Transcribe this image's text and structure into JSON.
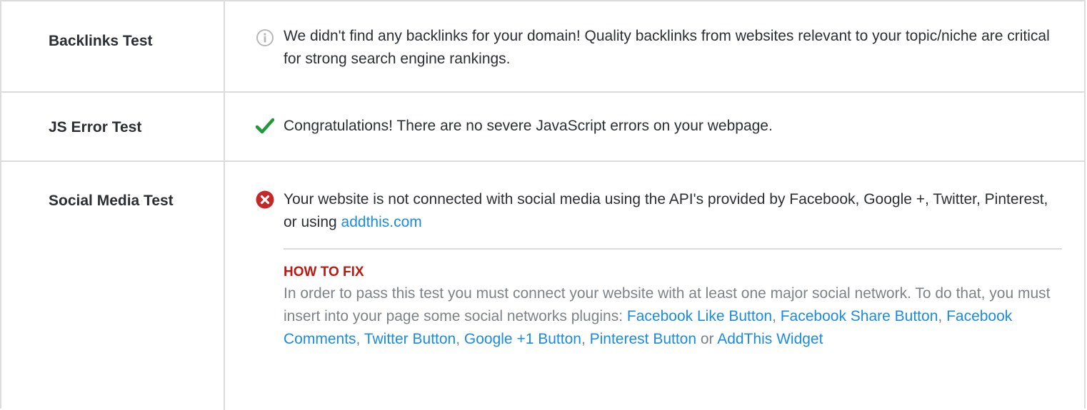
{
  "tests": [
    {
      "name": "Backlinks Test",
      "status_icon": "info-icon",
      "message": "We didn't find any backlinks for your domain! Quality backlinks from websites relevant to your topic/niche are critical for strong search engine rankings."
    },
    {
      "name": "JS Error Test",
      "status_icon": "check-icon",
      "message": "Congratulations! There are no severe JavaScript errors on your webpage."
    },
    {
      "name": "Social Media Test",
      "status_icon": "error-icon",
      "message_prefix": "Your website is not connected with social media using the API's provided by Facebook, Google +, Twitter, Pinterest, or using ",
      "message_link": "addthis.com",
      "how_to_fix": {
        "title": "HOW TO FIX",
        "intro": "In order to pass this test you must connect your website with at least one major social network. To do that, you must insert into your page some social networks plugins: ",
        "links": [
          "Facebook Like Button",
          "Facebook Share Button",
          "Facebook Comments",
          "Twitter Button",
          "Google +1 Button",
          "Pinterest Button"
        ],
        "separator": ", ",
        "or_text": " or ",
        "last_link": "AddThis Widget"
      }
    }
  ],
  "colors": {
    "border": "#dcdcdc",
    "text": "#2b2f33",
    "muted_text": "#7d8287",
    "link": "#1a8ce0",
    "fix_title": "#c0170f",
    "success": "#1f9a3a",
    "error": "#c62828",
    "info": "#b8b8b8"
  }
}
